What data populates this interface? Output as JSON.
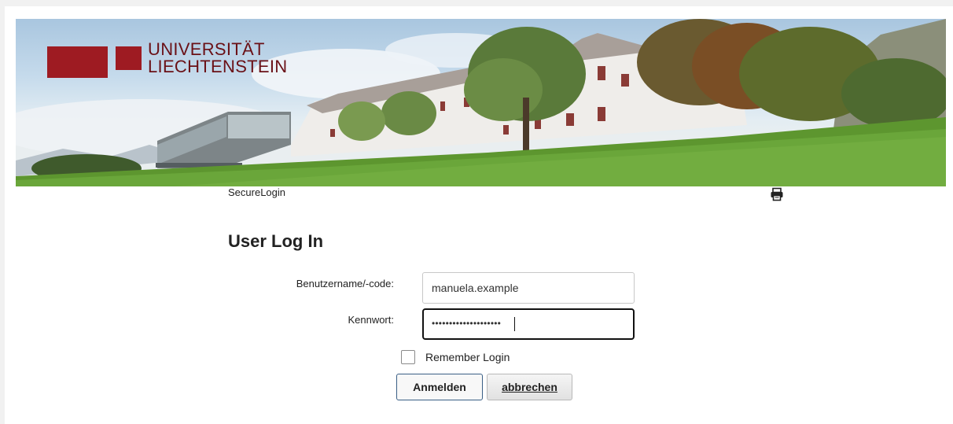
{
  "banner": {
    "logo_line1": "UNIVERSITÄT",
    "logo_line2": "LIECHTENSTEIN",
    "brand_color": "#9e1b22"
  },
  "breadcrumb": "SecureLogin",
  "print_icon": "printer-icon",
  "form": {
    "title": "User Log In",
    "username_label": "Benutzername/-code:",
    "username_value": "manuela.example",
    "password_label": "Kennwort:",
    "password_value": "••••••••••••••••••••",
    "remember_label": "Remember Login",
    "remember_checked": false,
    "login_button": "Anmelden",
    "cancel_button": "abbrechen"
  }
}
